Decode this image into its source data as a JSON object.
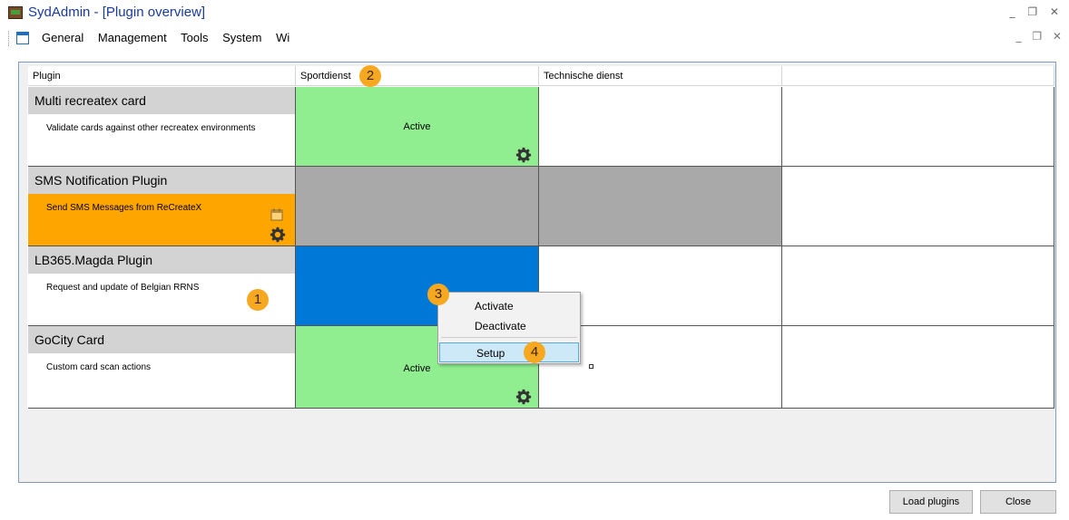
{
  "window": {
    "title": "SydAdmin - [Plugin overview]",
    "controls": "_ ❐ ✕",
    "mdi_controls": "_ ❐ ✕"
  },
  "menu": {
    "items": [
      "General",
      "Management",
      "Tools",
      "System",
      "Wi"
    ]
  },
  "grid": {
    "columns": [
      "Plugin",
      "Sportdienst",
      "Technische dienst",
      ""
    ],
    "rows": [
      {
        "title": "Multi recreatex card",
        "description": "Validate cards against other recreatex environments",
        "sportdienst": "Active"
      },
      {
        "title": "SMS Notification Plugin",
        "description": "Send SMS Messages from ReCreateX"
      },
      {
        "title": "LB365.Magda Plugin",
        "description": "Request and update of Belgian RRNS"
      },
      {
        "title": "GoCity Card",
        "description": "Custom card scan actions",
        "sportdienst": "Active"
      }
    ]
  },
  "context_menu": {
    "items": [
      "Activate",
      "Deactivate",
      "Setup"
    ]
  },
  "badges": [
    "1",
    "2",
    "3",
    "4"
  ],
  "buttons": {
    "load": "Load plugins",
    "close": "Close"
  },
  "colors": {
    "active_green": "#90ee90",
    "inactive_gray": "#a9a9a9",
    "selected_blue": "#0078d7",
    "orange_row": "#ffa500",
    "badge": "#f6a821"
  }
}
